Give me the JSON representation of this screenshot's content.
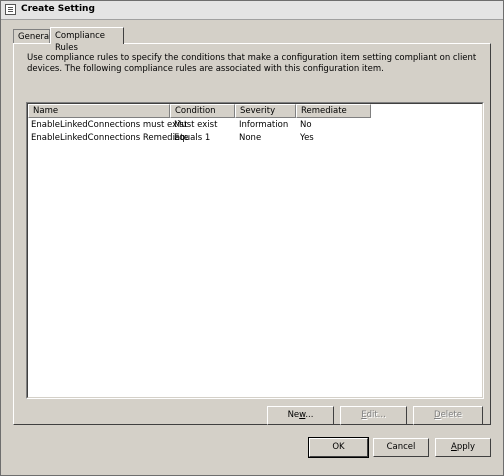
{
  "window": {
    "title": "Create Setting"
  },
  "tabs": [
    {
      "label": "General",
      "active": false
    },
    {
      "label": "Compliance Rules",
      "active": true
    }
  ],
  "description": "Use compliance rules to specify the conditions that make a configuration item setting compliant on client devices. The following compliance rules are associated with this configuration item.",
  "table": {
    "columns": [
      "Name",
      "Condition",
      "Severity",
      "Remediate"
    ],
    "rows": [
      {
        "name": "EnableLinkedConnections must exist",
        "condition": "Must exist",
        "severity": "Information",
        "remediate": "No"
      },
      {
        "name": "EnableLinkedConnections Remediate",
        "condition": "Equals 1",
        "severity": "None",
        "remediate": "Yes"
      }
    ]
  },
  "list_buttons": {
    "new_pre": "Ne",
    "new_key": "w",
    "new_post": "...",
    "edit_key": "E",
    "edit_post": "dit...",
    "delete_key": "D",
    "delete_post": "elete"
  },
  "dialog_buttons": {
    "ok": "OK",
    "cancel": "Cancel",
    "apply_key": "A",
    "apply_post": "pply"
  }
}
